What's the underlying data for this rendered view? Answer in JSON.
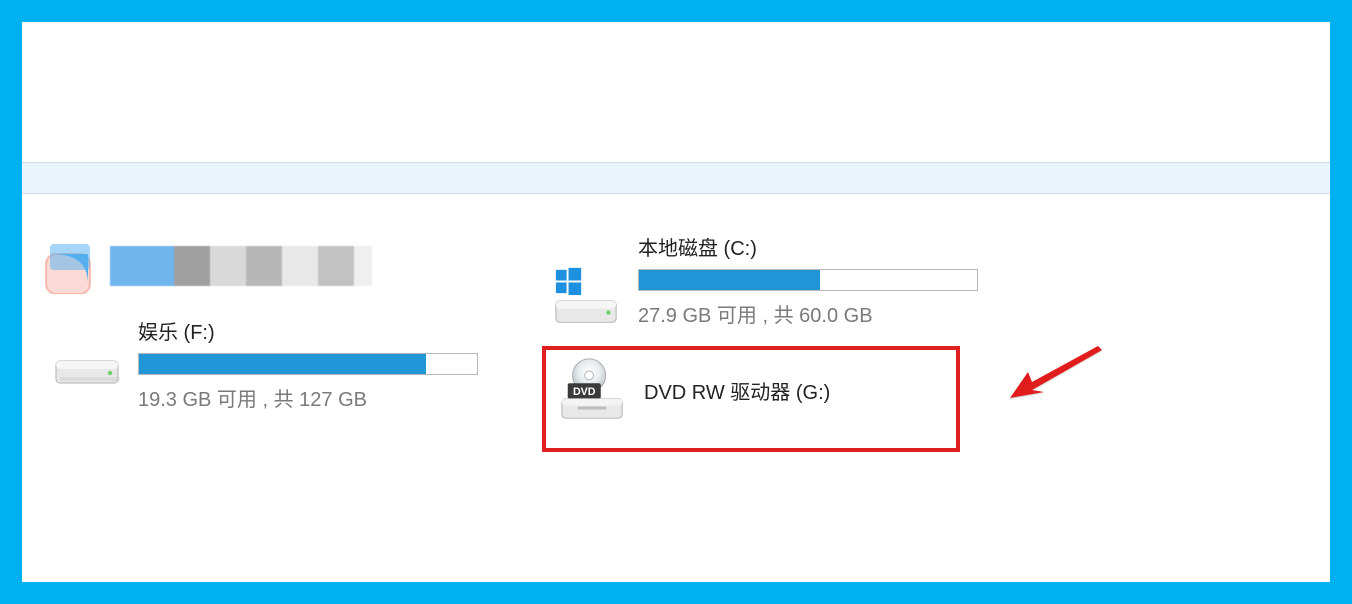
{
  "drives": {
    "c": {
      "title": "本地磁盘 (C:)",
      "subtitle": "27.9 GB 可用 , 共 60.0 GB",
      "fill_percent": 53.5
    },
    "f": {
      "title": "娱乐 (F:)",
      "subtitle": "19.3 GB 可用 , 共 127 GB",
      "fill_percent": 85
    },
    "g": {
      "title": "DVD RW 驱动器 (G:)"
    }
  }
}
